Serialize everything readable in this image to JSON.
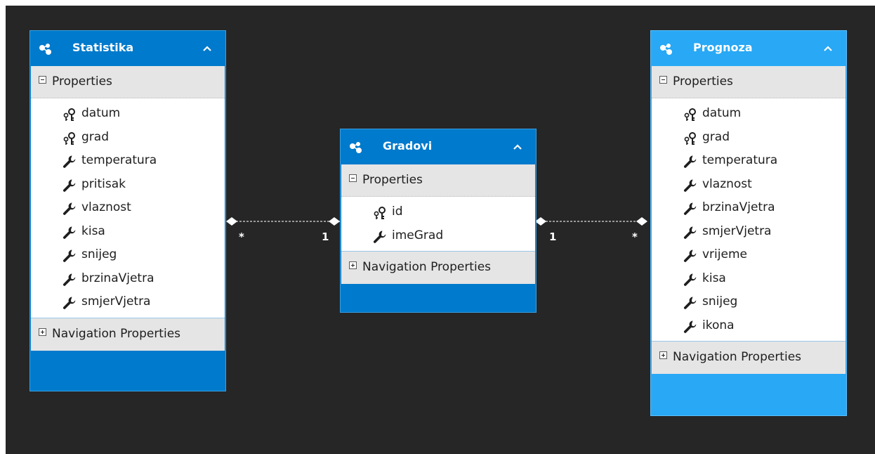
{
  "entities": {
    "statistika": {
      "title": "Statistika",
      "properties_label": "Properties",
      "navigation_label": "Navigation Properties",
      "properties": [
        {
          "name": "datum",
          "icon": "key-icon"
        },
        {
          "name": "grad",
          "icon": "key-icon"
        },
        {
          "name": "temperatura",
          "icon": "wrench-icon"
        },
        {
          "name": "pritisak",
          "icon": "wrench-icon"
        },
        {
          "name": "vlaznost",
          "icon": "wrench-icon"
        },
        {
          "name": "kisa",
          "icon": "wrench-icon"
        },
        {
          "name": "snijeg",
          "icon": "wrench-icon"
        },
        {
          "name": "brzinaVjetra",
          "icon": "wrench-icon"
        },
        {
          "name": "smjerVjetra",
          "icon": "wrench-icon"
        }
      ]
    },
    "gradovi": {
      "title": "Gradovi",
      "properties_label": "Properties",
      "navigation_label": "Navigation Properties",
      "properties": [
        {
          "name": "id",
          "icon": "key-icon"
        },
        {
          "name": "imeGrad",
          "icon": "wrench-icon"
        }
      ]
    },
    "prognoza": {
      "title": "Prognoza",
      "properties_label": "Properties",
      "navigation_label": "Navigation Properties",
      "properties": [
        {
          "name": "datum",
          "icon": "key-icon"
        },
        {
          "name": "grad",
          "icon": "key-icon"
        },
        {
          "name": "temperatura",
          "icon": "wrench-icon"
        },
        {
          "name": "vlaznost",
          "icon": "wrench-icon"
        },
        {
          "name": "brzinaVjetra",
          "icon": "wrench-icon"
        },
        {
          "name": "smjerVjetra",
          "icon": "wrench-icon"
        },
        {
          "name": "vrijeme",
          "icon": "wrench-icon"
        },
        {
          "name": "kisa",
          "icon": "wrench-icon"
        },
        {
          "name": "snijeg",
          "icon": "wrench-icon"
        },
        {
          "name": "ikona",
          "icon": "wrench-icon"
        }
      ]
    }
  },
  "associations": [
    {
      "from": "statistika",
      "to": "gradovi",
      "from_mult": "*",
      "to_mult": "1"
    },
    {
      "from": "gradovi",
      "to": "prognoza",
      "from_mult": "1",
      "to_mult": "*"
    }
  ],
  "colors": {
    "canvas": "#262626",
    "entity": "#007acc",
    "entity_selected": "#28a8f5",
    "section_header": "#e5e5e5",
    "connector": "#bdbdbd"
  }
}
